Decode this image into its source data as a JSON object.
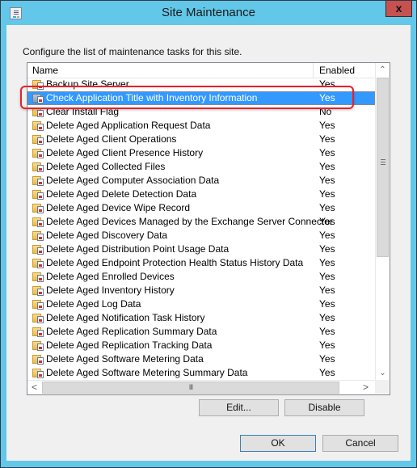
{
  "window": {
    "title": "Site Maintenance",
    "icon": "properties-window-icon",
    "close_label": "x"
  },
  "description": "Configure the list of maintenance tasks for this site.",
  "list": {
    "columns": {
      "name": "Name",
      "enabled": "Enabled"
    },
    "selected_index": 1,
    "rows": [
      {
        "name": "Backup Site Server",
        "enabled": "Yes"
      },
      {
        "name": "Check Application Title with Inventory Information",
        "enabled": "Yes"
      },
      {
        "name": "Clear Install Flag",
        "enabled": "No"
      },
      {
        "name": "Delete Aged Application Request Data",
        "enabled": "Yes"
      },
      {
        "name": "Delete Aged Client Operations",
        "enabled": "Yes"
      },
      {
        "name": "Delete Aged Client Presence History",
        "enabled": "Yes"
      },
      {
        "name": "Delete Aged Collected Files",
        "enabled": "Yes"
      },
      {
        "name": "Delete Aged Computer Association Data",
        "enabled": "Yes"
      },
      {
        "name": "Delete Aged Delete Detection Data",
        "enabled": "Yes"
      },
      {
        "name": "Delete Aged Device Wipe Record",
        "enabled": "Yes"
      },
      {
        "name": "Delete Aged Devices Managed by the Exchange Server Connector",
        "enabled": "Yes"
      },
      {
        "name": "Delete Aged Discovery Data",
        "enabled": "Yes"
      },
      {
        "name": "Delete Aged Distribution Point Usage Data",
        "enabled": "Yes"
      },
      {
        "name": "Delete Aged Endpoint Protection Health Status History Data",
        "enabled": "Yes"
      },
      {
        "name": "Delete Aged Enrolled Devices",
        "enabled": "Yes"
      },
      {
        "name": "Delete Aged Inventory History",
        "enabled": "Yes"
      },
      {
        "name": "Delete Aged Log Data",
        "enabled": "Yes"
      },
      {
        "name": "Delete Aged Notification Task History",
        "enabled": "Yes"
      },
      {
        "name": "Delete Aged Replication Summary Data",
        "enabled": "Yes"
      },
      {
        "name": "Delete Aged Replication Tracking Data",
        "enabled": "Yes"
      },
      {
        "name": "Delete Aged Software Metering Data",
        "enabled": "Yes"
      },
      {
        "name": "Delete Aged Software Metering Summary Data",
        "enabled": "Yes"
      }
    ],
    "scroll": {
      "up_glyph": "^",
      "down_glyph": "v",
      "left_glyph": "<",
      "right_glyph": ">",
      "h_grip": "III"
    }
  },
  "buttons": {
    "edit": "Edit...",
    "disable": "Disable",
    "ok": "OK",
    "cancel": "Cancel"
  },
  "colors": {
    "title_bar": "#62c7e8",
    "close_button": "#c75050",
    "selection": "#3399ff",
    "annotation_highlight": "#e8202a"
  }
}
